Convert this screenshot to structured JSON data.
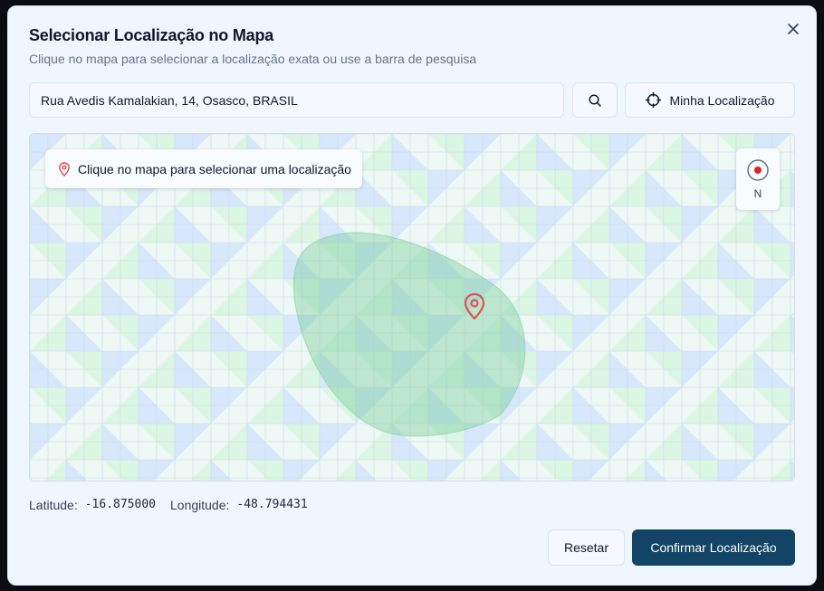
{
  "dialog": {
    "title": "Selecionar Localização no Mapa",
    "subtitle": "Clique no mapa para selecionar a localização exata ou use a barra de pesquisa",
    "close_icon": "x-icon"
  },
  "search": {
    "value": "Rua Avedis Kamalakian, 14, Osasco, BRASIL",
    "search_icon": "search-icon",
    "my_location_label": "Minha Localização",
    "my_location_icon": "crosshair-icon"
  },
  "map": {
    "hint_text": "Clique no mapa para selecionar uma localização",
    "hint_icon": "map-pin-icon",
    "compass_label": "N",
    "marker_icon": "map-pin-icon",
    "colors": {
      "tile_blue": "#d8e8fc",
      "tile_green": "#dcf6e4",
      "tile_light": "#eef9f5",
      "area_fill": "#8fd3ab",
      "marker": "#e05252"
    }
  },
  "coordinates": {
    "latitude_label": "Latitude:",
    "latitude_value": "-16.875000",
    "longitude_label": "Longitude:",
    "longitude_value": "-48.794431"
  },
  "actions": {
    "reset_label": "Resetar",
    "confirm_label": "Confirmar Localização",
    "confirm_color": "#124565"
  }
}
